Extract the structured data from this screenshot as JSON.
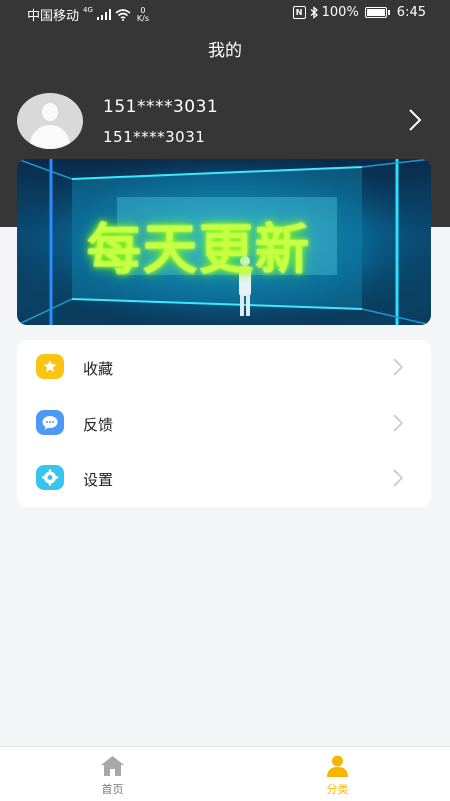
{
  "status_bar": {
    "carrier": "中国移动",
    "network": "4G",
    "speed_value": "0",
    "speed_unit": "K/s",
    "battery": "100%",
    "time": "6:45"
  },
  "header": {
    "title": "我的"
  },
  "profile": {
    "name": "151****3031",
    "phone": "151****3031"
  },
  "banner": {
    "text": "每天更新"
  },
  "menu": {
    "items": [
      {
        "label": "收藏",
        "icon": "star-icon",
        "color": "#f9c511"
      },
      {
        "label": "反馈",
        "icon": "chat-bubble-icon",
        "color": "#4d9af6"
      },
      {
        "label": "设置",
        "icon": "gear-icon",
        "color": "#35c5ef"
      }
    ]
  },
  "tabbar": {
    "tabs": [
      {
        "label": "首页",
        "icon": "home-icon",
        "active": false
      },
      {
        "label": "分类",
        "icon": "person-icon",
        "active": true
      }
    ],
    "active_color": "#f8b500",
    "inactive_color": "#a8a8a8"
  },
  "colors": {
    "header_bg": "#363636",
    "page_bg": "#f4f5f7",
    "banner_neon": "#c8ff44"
  }
}
